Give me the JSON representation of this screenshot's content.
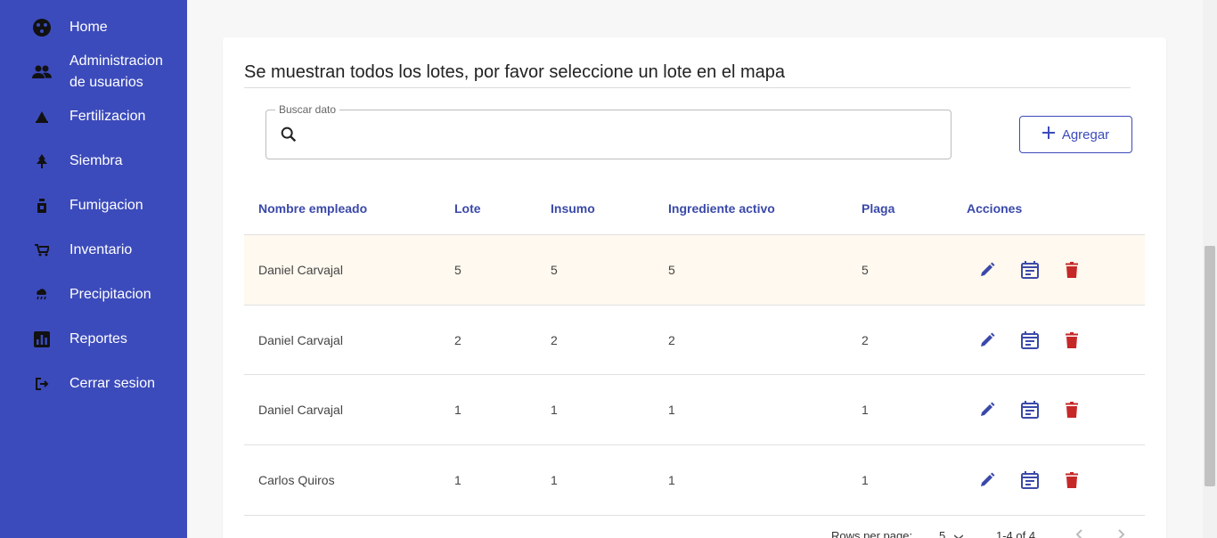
{
  "sidebar": {
    "items": [
      {
        "label": "Home",
        "icon": "home-icon"
      },
      {
        "label": "Administracion de usuarios",
        "line1": "Administracion",
        "line2": "de usuarios",
        "icon": "users-icon"
      },
      {
        "label": "Fertilizacion",
        "icon": "fertilizer-icon"
      },
      {
        "label": "Siembra",
        "icon": "tree-icon"
      },
      {
        "label": "Fumigacion",
        "icon": "spray-icon"
      },
      {
        "label": "Inventario",
        "icon": "cart-icon"
      },
      {
        "label": "Precipitacion",
        "icon": "rain-icon"
      },
      {
        "label": "Reportes",
        "icon": "chart-icon"
      },
      {
        "label": "Cerrar sesion",
        "icon": "logout-icon"
      }
    ]
  },
  "main": {
    "title": "Se muestran todos los lotes, por favor seleccione un lote en el mapa",
    "search": {
      "label": "Buscar dato",
      "value": "",
      "placeholder": ""
    },
    "add_label": "Agregar",
    "table": {
      "headers": [
        "Nombre empleado",
        "Lote",
        "Insumo",
        "Ingrediente activo",
        "Plaga",
        "Acciones"
      ],
      "rows": [
        [
          "Daniel Carvajal",
          "5",
          "5",
          "5",
          "5"
        ],
        [
          "Daniel Carvajal",
          "2",
          "2",
          "2",
          "2"
        ],
        [
          "Daniel Carvajal",
          "1",
          "1",
          "1",
          "1"
        ],
        [
          "Carlos Quiros",
          "1",
          "1",
          "1",
          "1"
        ]
      ]
    },
    "pagination": {
      "rows_per_page_label": "Rows per page:",
      "rows_per_page": "5",
      "range": "1-4 of 4"
    }
  },
  "colors": {
    "sidebar": "#3c4bbb",
    "accent": "#3a49a9",
    "delete": "#c62828",
    "highlight": "#fff9ef"
  }
}
